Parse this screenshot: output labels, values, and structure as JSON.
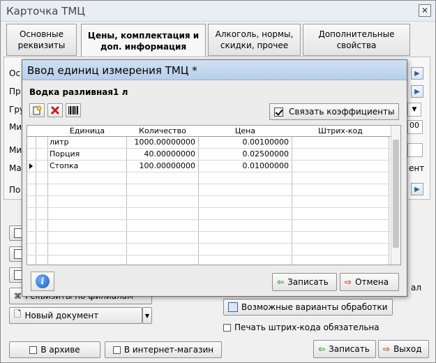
{
  "window": {
    "title": "Карточка ТМЦ",
    "close_glyph": "✕"
  },
  "tabs": [
    {
      "label": "Основные\nреквизиты"
    },
    {
      "label": "Цены, комплектация и\nдоп.  информация"
    },
    {
      "label": "Алкоголь, нормы,\nскидки, прочее"
    },
    {
      "label": "Дополнительные\nсвойства"
    }
  ],
  "background": {
    "partial_labels": [
      "Ос",
      "Пр",
      "Гру",
      "Ми",
      "Ми",
      "Ма",
      "По"
    ],
    "right_fragments": [
      "00",
      "ент"
    ],
    "filial_button": "Реквизиты по филиалам",
    "new_doc": "Новый документ",
    "processing_button": "Возможные варианты обработки",
    "barcode_required": "Печать штрих-кода обязательна",
    "archive": "В архиве",
    "internet_shop": "В интернет-магазин",
    "save": "Записать",
    "exit": "Выход",
    "right_cut": "ал"
  },
  "dialog": {
    "title": "Ввод единиц измерения ТМЦ *",
    "item_name": "Водка разливная1 л",
    "link_coefficients": "Связать коэффициенты",
    "columns": [
      "Единица",
      "Количество",
      "Цена",
      "Штрих-код"
    ],
    "rows": [
      {
        "unit": "литр",
        "qty": "1000.00000000",
        "price": "0.00100000",
        "barcode": ""
      },
      {
        "unit": "Порция",
        "qty": "40.00000000",
        "price": "0.02500000",
        "barcode": ""
      },
      {
        "unit": "Стопка",
        "qty": "100.00000000",
        "price": "0.01000000",
        "barcode": ""
      }
    ],
    "save": "Записать",
    "cancel": "Отмена",
    "info_glyph": "i"
  }
}
